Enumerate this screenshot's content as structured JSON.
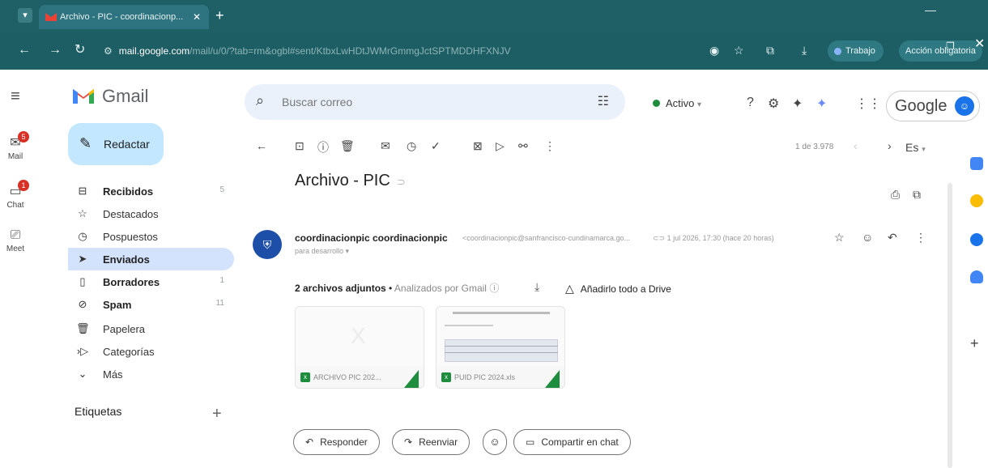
{
  "browser": {
    "tab_title": "Archivo - PIC - coordinacionp...",
    "tab_close": "✕",
    "new_tab": "+",
    "url_host": "mail.google.com",
    "url_path": "/mail/u/0/?tab=rm&ogbl#sent/KtbxLwHDtJWMrGmmgJctSPTMDDHFXNJV",
    "profile_label": "Trabajo",
    "update_label": "Acción obligatoria",
    "icons": [
      "back-icon",
      "forward-icon",
      "reload-icon",
      "site-info-icon",
      "eye-icon",
      "star-icon",
      "extensions-icon",
      "download-icon",
      "menu-icon"
    ]
  },
  "gmail": {
    "logo_text": "Gmail",
    "search_placeholder": "Buscar correo",
    "status_label": "Activo",
    "account_label": "Google",
    "compose_label": "Redactar",
    "rail": [
      {
        "label": "Mail",
        "badge": "5"
      },
      {
        "label": "Chat",
        "badge": "1"
      },
      {
        "label": "Meet",
        "badge": ""
      }
    ],
    "nav": [
      {
        "label": "Recibidos",
        "count": "5",
        "bold": true,
        "icon": "inbox-icon"
      },
      {
        "label": "Destacados",
        "count": "",
        "bold": false,
        "icon": "star-icon"
      },
      {
        "label": "Pospuestos",
        "count": "",
        "bold": false,
        "icon": "clock-icon"
      },
      {
        "label": "Enviados",
        "count": "",
        "bold": true,
        "icon": "send-icon"
      },
      {
        "label": "Borradores",
        "count": "1",
        "bold": true,
        "icon": "draft-icon"
      },
      {
        "label": "Spam",
        "count": "11",
        "bold": true,
        "icon": "spam-icon"
      },
      {
        "label": "Papelera",
        "count": "",
        "bold": false,
        "icon": "trash-icon"
      },
      {
        "label": "Categorías",
        "count": "",
        "bold": false,
        "icon": "label-icon"
      },
      {
        "label": "Más",
        "count": "",
        "bold": false,
        "icon": "chevron-down-icon"
      }
    ],
    "labels_heading": "Etiquetas",
    "pager_text": "1 de 3.978",
    "input_lang": "Es"
  },
  "message": {
    "subject": "Archivo - PIC",
    "sender_name": "coordinacionpic coordinacionpic",
    "sender_email": "<coordinacionpic@sanfrancisco-cundinamarca.go...",
    "recipient": "para desarrollo",
    "date": "1 jul 2026, 17:30 (hace 20 horas)",
    "attachments_count_label": "2 archivos adjuntos",
    "scanned_label": "Analizados por Gmail",
    "drive_label": "Añadirlo todo a Drive",
    "attachments": [
      {
        "name": "ARCHIVO PIC 202..."
      },
      {
        "name": "PUID PIC 2024.xls"
      }
    ],
    "reply_label": "Responder",
    "forward_label": "Reenviar",
    "share_chat_label": "Compartir en chat"
  },
  "colors": {
    "chrome_bg": "#1c5e64",
    "compose_bg": "#c2e7ff",
    "active_nav_bg": "#d3e3fd",
    "search_bg": "#eaf1fb",
    "badge_red": "#d93025",
    "excel_green": "#1e8e3e"
  }
}
